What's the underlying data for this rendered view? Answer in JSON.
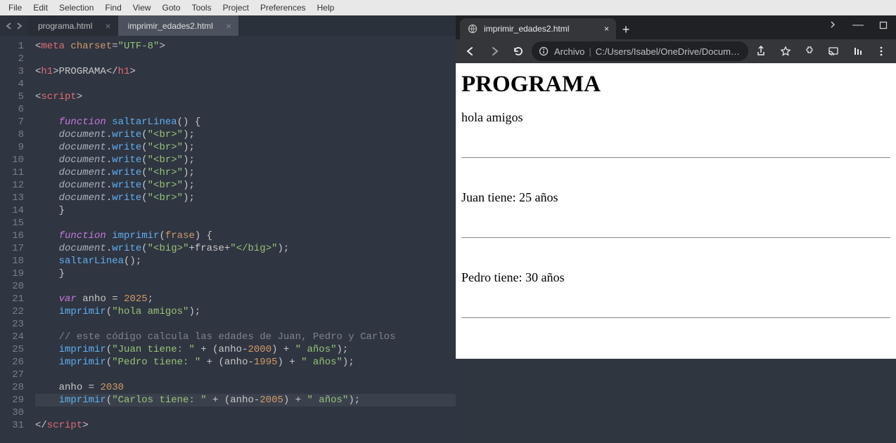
{
  "menubar": [
    "File",
    "Edit",
    "Selection",
    "Find",
    "View",
    "Goto",
    "Tools",
    "Project",
    "Preferences",
    "Help"
  ],
  "editor": {
    "tabs": [
      {
        "label": "programa.html",
        "active": false
      },
      {
        "label": "imprimir_edades2.html",
        "active": true
      }
    ],
    "lines": 31,
    "selected_line": 29,
    "tokens": {
      "l1": {
        "a": "meta",
        "b": "charset",
        "c": "=",
        "d": "\"UTF-8\""
      },
      "l3": {
        "a": "h1",
        "b": "PROGRAMA",
        "c": "h1"
      },
      "l5": {
        "a": "script"
      },
      "l7": {
        "a": "function",
        "b": "saltarLinea",
        "c": "() {"
      },
      "l8": {
        "a": "document",
        "b": ".",
        "c": "write",
        "d": "(",
        "e": "\"<br>\"",
        "f": ");"
      },
      "l9": {
        "a": "document",
        "b": ".",
        "c": "write",
        "d": "(",
        "e": "\"<br>\"",
        "f": ");"
      },
      "l10": {
        "a": "document",
        "b": ".",
        "c": "write",
        "d": "(",
        "e": "\"<br>\"",
        "f": ");"
      },
      "l11": {
        "a": "document",
        "b": ".",
        "c": "write",
        "d": "(",
        "e": "\"<hr>\"",
        "f": ");"
      },
      "l12": {
        "a": "document",
        "b": ".",
        "c": "write",
        "d": "(",
        "e": "\"<br>\"",
        "f": ");"
      },
      "l13": {
        "a": "document",
        "b": ".",
        "c": "write",
        "d": "(",
        "e": "\"<br>\"",
        "f": ");"
      },
      "l14": {
        "a": "}"
      },
      "l16": {
        "a": "function",
        "b": "imprimir",
        "c": "(",
        "d": "frase",
        "e": ") {"
      },
      "l17": {
        "a": "document",
        "b": ".",
        "c": "write",
        "d": "(",
        "e": "\"<big>\"",
        "f": "+",
        "g": "frase",
        "h": "+",
        "i": "\"</big>\"",
        "j": ");"
      },
      "l18": {
        "a": "saltarLinea",
        "b": "();"
      },
      "l19": {
        "a": "}"
      },
      "l21": {
        "a": "var",
        "b": "anho",
        "c": " = ",
        "d": "2025",
        "e": ";"
      },
      "l22": {
        "a": "imprimir",
        "b": "(",
        "c": "\"hola amigos\"",
        "d": ");"
      },
      "l24": {
        "a": "// este código calcula las edades de Juan, Pedro y Carlos"
      },
      "l25": {
        "a": "imprimir",
        "b": "(",
        "c": "\"Juan tiene: \"",
        "d": " + (",
        "e": "anho",
        "f": "-",
        "g": "2000",
        "h": ") + ",
        "i": "\" años\"",
        "j": ");"
      },
      "l26": {
        "a": "imprimir",
        "b": "(",
        "c": "\"Pedro tiene: \"",
        "d": " + (",
        "e": "anho",
        "f": "-",
        "g": "1995",
        "h": ") + ",
        "i": "\" años\"",
        "j": ");"
      },
      "l28": {
        "a": "anho",
        "b": " = ",
        "c": "2030"
      },
      "l29": {
        "a": "imprimir",
        "b": "(",
        "c": "\"Carlos tiene: \"",
        "d": " + (",
        "e": "anho",
        "f": "-",
        "g": "2005",
        "h": ") + ",
        "i": "\" años\"",
        "j": ");"
      },
      "l31": {
        "a": "script"
      }
    }
  },
  "browser": {
    "tab_title": "imprimir_edades2.html",
    "url_label": "Archivo",
    "url_text": "C:/Users/Isabel/OneDrive/Docum…",
    "page": {
      "title": "PROGRAMA",
      "line1": "hola amigos",
      "line2": "Juan tiene: 25 años",
      "line3": "Pedro tiene: 30 años"
    }
  }
}
